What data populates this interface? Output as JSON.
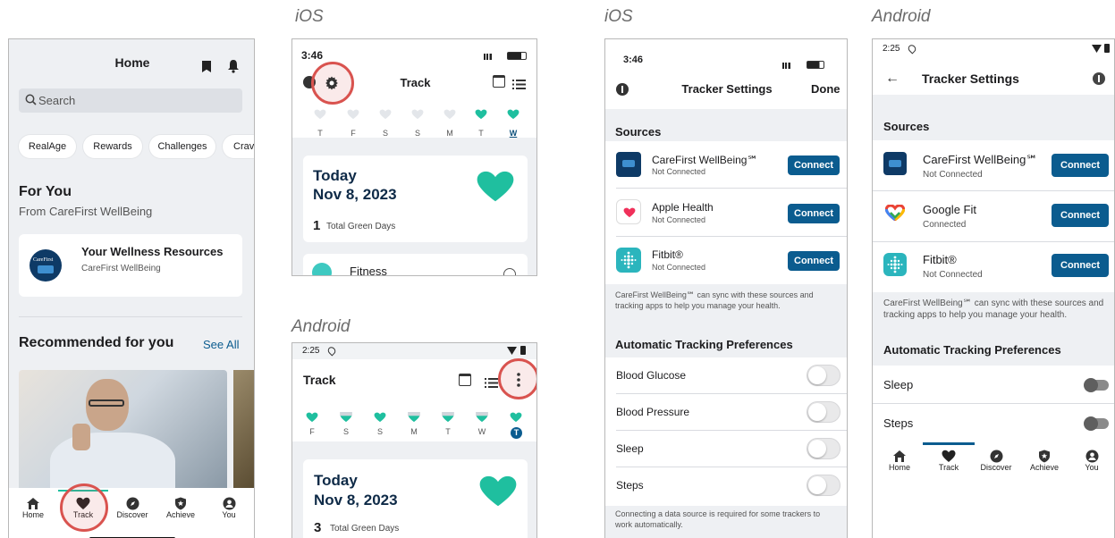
{
  "labels": {
    "ios1": "iOS",
    "ios2": "iOS",
    "android1": "Android",
    "android2": "Android"
  },
  "home": {
    "title": "Home",
    "search_placeholder": "Search",
    "chips": [
      "RealAge",
      "Rewards",
      "Challenges",
      "Crav"
    ],
    "for_you": "For You",
    "from": "From CareFirst WellBeing",
    "card_title": "Your Wellness Resources",
    "card_sub": "CareFirst WellBeing",
    "recommended": "Recommended for you",
    "see_all": "See All",
    "tabs": [
      "Home",
      "Track",
      "Discover",
      "Achieve",
      "You"
    ]
  },
  "track_ios": {
    "time": "3:46",
    "title": "Track",
    "days": [
      "T",
      "F",
      "S",
      "S",
      "M",
      "T",
      "W"
    ],
    "today": "Today",
    "date": "Nov 8, 2023",
    "green_days": "1",
    "green_days_label": "Total Green Days",
    "fitness": "Fitness"
  },
  "track_android": {
    "time": "2:25",
    "title": "Track",
    "days": [
      "F",
      "S",
      "S",
      "M",
      "T",
      "W",
      "T"
    ],
    "today": "Today",
    "date": "Nov 8, 2023",
    "green_days": "3",
    "green_days_label": "Total Green Days"
  },
  "settings_ios": {
    "time": "3:46",
    "title": "Tracker Settings",
    "done": "Done",
    "sources_header": "Sources",
    "sources": [
      {
        "name": "CareFirst WellBeing℠",
        "status": "Not Connected",
        "button": "Connect"
      },
      {
        "name": "Apple Health",
        "status": "Not Connected",
        "button": "Connect"
      },
      {
        "name": "Fitbit®",
        "status": "Not Connected",
        "button": "Connect"
      }
    ],
    "note": "CareFirst WellBeing℠ can sync with these sources and tracking apps to help you manage your health.",
    "prefs_header": "Automatic Tracking Preferences",
    "prefs": [
      "Blood Glucose",
      "Blood Pressure",
      "Sleep",
      "Steps"
    ],
    "footer": "Connecting a data source is required for some trackers to work automatically."
  },
  "settings_android": {
    "time": "2:25",
    "title": "Tracker Settings",
    "sources_header": "Sources",
    "sources": [
      {
        "name": "CareFirst WellBeing℠",
        "status": "Not Connected",
        "button": "Connect"
      },
      {
        "name": "Google Fit",
        "status": "Connected",
        "button": "Connect"
      },
      {
        "name": "Fitbit®",
        "status": "Not Connected",
        "button": "Connect"
      }
    ],
    "note": "CareFirst WellBeing℠ can sync with these sources and tracking apps to help you manage your health.",
    "prefs_header": "Automatic Tracking Preferences",
    "prefs": [
      "Sleep",
      "Steps"
    ],
    "tabs": [
      "Home",
      "Track",
      "Discover",
      "Achieve",
      "You"
    ]
  },
  "colors": {
    "teal": "#1fbf9f",
    "navy": "#0b5c8f",
    "highlight": "#d9534f"
  }
}
